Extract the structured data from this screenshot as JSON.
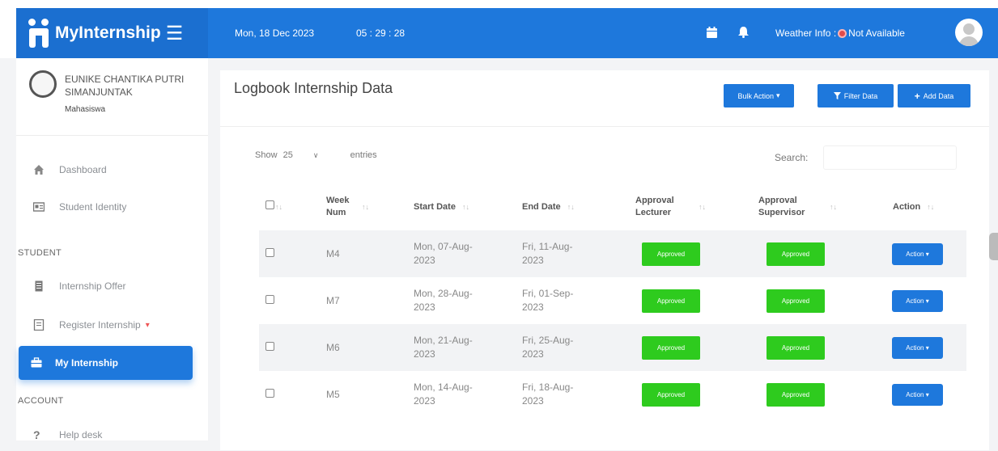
{
  "brand": {
    "name": "MyInternship"
  },
  "topbar": {
    "date": "Mon, 18 Dec 2023",
    "time": "05 : 29 : 28",
    "weather_label": "Weather Info :",
    "weather_value": "Not Available"
  },
  "profile": {
    "name": "EUNIKE CHANTIKA PUTRI SIMANJUNTAK",
    "role": "Mahasiswa"
  },
  "sidebar": {
    "items": [
      {
        "label": "Dashboard",
        "icon": "home-icon"
      },
      {
        "label": "Student Identity",
        "icon": "id-card-icon"
      }
    ],
    "section_student": "STUDENT",
    "student_items": [
      {
        "label": "Internship Offer",
        "icon": "document-icon"
      },
      {
        "label": "Register Internship",
        "icon": "form-icon"
      }
    ],
    "active_item": {
      "label": "My Internship",
      "icon": "briefcase-icon"
    },
    "section_account": "ACCOUNT",
    "account_items": [
      {
        "label": "Help desk",
        "icon": "help-icon"
      }
    ]
  },
  "page": {
    "title": "Logbook Internship Data",
    "bulk_action": "Bulk Action",
    "filter_data": "Filter Data",
    "add_data": "Add Data"
  },
  "table_controls": {
    "show": "Show",
    "entries_value": "25",
    "entries": "entries",
    "search_label": "Search:"
  },
  "table": {
    "headers": {
      "week": "Week Num",
      "start": "Start Date",
      "end": "End Date",
      "lecturer": "Approval Lecturer",
      "supervisor": "Approval Supervisor",
      "action": "Action"
    },
    "rows": [
      {
        "week": "M4",
        "start": "Mon, 07-Aug-2023",
        "end": "Fri, 11-Aug-2023",
        "lecturer": "Approved",
        "supervisor": "Approved",
        "action": "Action"
      },
      {
        "week": "M7",
        "start": "Mon, 28-Aug-2023",
        "end": "Fri, 01-Sep-2023",
        "lecturer": "Approved",
        "supervisor": "Approved",
        "action": "Action"
      },
      {
        "week": "M6",
        "start": "Mon, 21-Aug-2023",
        "end": "Fri, 25-Aug-2023",
        "lecturer": "Approved",
        "supervisor": "Approved",
        "action": "Action"
      },
      {
        "week": "M5",
        "start": "Mon, 14-Aug-2023",
        "end": "Fri, 18-Aug-2023",
        "lecturer": "Approved",
        "supervisor": "Approved",
        "action": "Action"
      }
    ]
  },
  "colors": {
    "primary": "#1e78dc",
    "approved": "#2ecb1e",
    "alert": "#e04b4b"
  }
}
